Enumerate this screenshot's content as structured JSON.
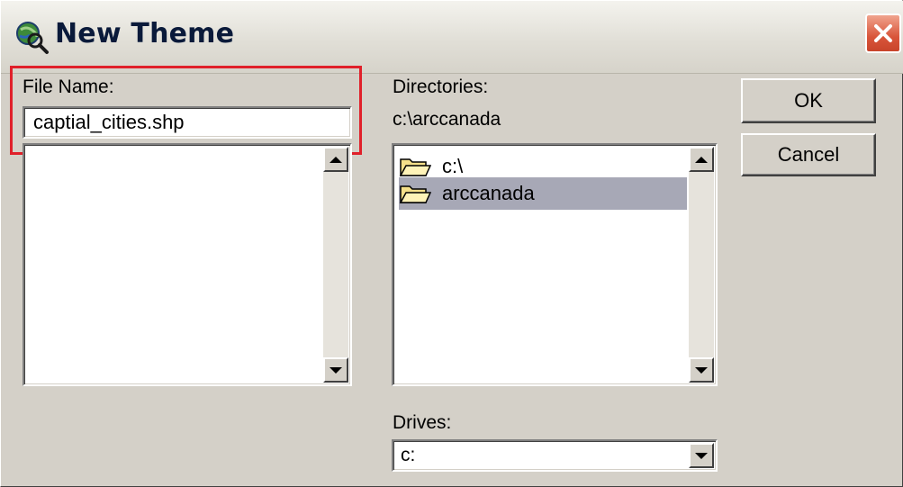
{
  "window": {
    "title": "New Theme",
    "title_icon": "globe-magnifier-icon",
    "close_icon": "close-icon"
  },
  "file_name": {
    "label": "File Name:",
    "value": "captial_cities.shp",
    "files": []
  },
  "directories": {
    "label": "Directories:",
    "current_path": "c:\\arccanada",
    "items": [
      {
        "name": "c:\\",
        "icon": "open-folder-icon",
        "selected": false
      },
      {
        "name": "arccanada",
        "icon": "open-folder-icon",
        "selected": true
      }
    ]
  },
  "drives": {
    "label": "Drives:",
    "selected": "c:"
  },
  "buttons": {
    "ok": "OK",
    "cancel": "Cancel"
  },
  "colors": {
    "dialog_bg": "#d4d0c8",
    "highlight_border": "#e0202a",
    "selection_bg": "#a7a8b6",
    "close_button": "#d9553a"
  }
}
